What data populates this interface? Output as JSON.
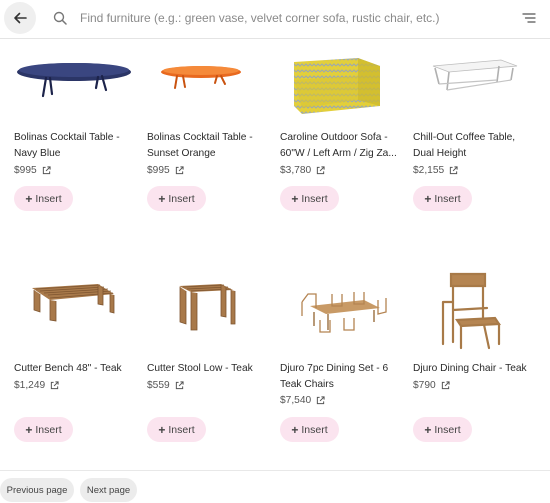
{
  "search": {
    "placeholder": "Find furniture (e.g.: green vase, velvet corner sofa, rustic chair, etc.)",
    "value": ""
  },
  "icons": {
    "back": "arrow-left-icon",
    "search": "search-icon",
    "filter": "filter-lines-icon",
    "external": "external-link-icon",
    "plus": "plus-icon"
  },
  "colors": {
    "insert_bg": "#fbe4ef",
    "pager_bg": "#ececec"
  },
  "insert_label": "Insert",
  "products": [
    {
      "name": "Bolinas Cocktail Table - Navy Blue",
      "price": "$995",
      "image": "navy oval cocktail table"
    },
    {
      "name": "Bolinas Cocktail Table - Sunset Orange",
      "price": "$995",
      "image": "orange oval cocktail table"
    },
    {
      "name": "Caroline Outdoor Sofa - 60\"W / Left Arm / Zig Za...",
      "price": "$3,780",
      "image": "yellow zig zag outdoor sofa"
    },
    {
      "name": "Chill-Out Coffee Table, Dual Height",
      "price": "$2,155",
      "image": "white coffee table"
    },
    {
      "name": "Cutter Bench 48\" - Teak",
      "price": "$1,249",
      "image": "teak slatted bench"
    },
    {
      "name": "Cutter Stool Low - Teak",
      "price": "$559",
      "image": "teak low stool"
    },
    {
      "name": "Djuro 7pc Dining Set - 6 Teak Chairs",
      "price": "$7,540",
      "image": "teak dining set"
    },
    {
      "name": "Djuro Dining Chair - Teak",
      "price": "$790",
      "image": "teak dining chair"
    }
  ],
  "pagination": {
    "previous": "Previous page",
    "next": "Next page"
  }
}
